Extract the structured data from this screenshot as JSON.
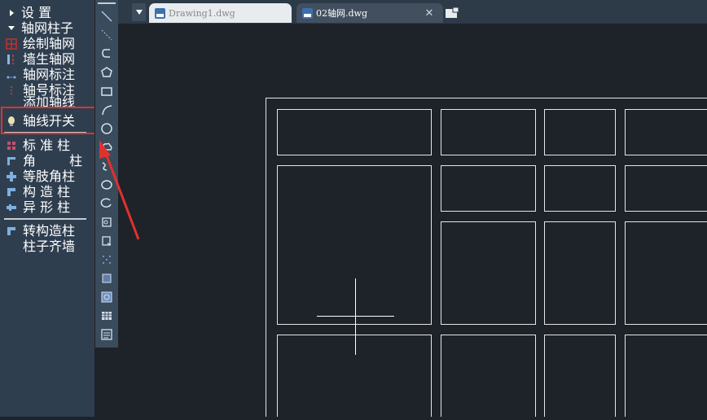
{
  "menu": {
    "items": [
      {
        "label": "设 置",
        "icon": "triangle-right-icon"
      },
      {
        "label": "轴网柱子",
        "icon": "triangle-down-icon"
      },
      {
        "label": "绘制轴网",
        "icon": "grid-icon"
      },
      {
        "label": "墙生轴网",
        "icon": "wall-axis-icon"
      },
      {
        "label": "轴网标注",
        "icon": "axis-dimension-icon"
      },
      {
        "label": "轴号标注",
        "icon": "axis-number-icon"
      },
      {
        "label": "添加轴线",
        "icon": "add-axis-icon"
      },
      {
        "label": "轴线开关",
        "icon": "bulb-icon"
      },
      {
        "label": "标 准 柱",
        "icon": "standard-column-icon"
      },
      {
        "label": "角 柱",
        "icon": "corner-column-icon"
      },
      {
        "label": "等肢角柱",
        "icon": "equal-leg-corner-column-icon"
      },
      {
        "label": "构 造 柱",
        "icon": "structural-column-icon"
      },
      {
        "label": "异 形 柱",
        "icon": "shaped-column-icon"
      },
      {
        "label": "转构造柱",
        "icon": "convert-structural-column-icon"
      },
      {
        "label": "柱子齐墙",
        "icon": "align-column-wall-icon"
      }
    ]
  },
  "toolbar": {
    "tools": [
      "line-icon",
      "construction-line-icon",
      "polyline-icon",
      "polygon-icon",
      "rectangle-icon",
      "arc-icon",
      "circle-icon",
      "revision-cloud-icon",
      "spline-icon",
      "ellipse-icon",
      "ellipse-arc-icon",
      "insert-block-icon",
      "make-block-icon",
      "point-icon",
      "hatch-icon",
      "gradient-icon",
      "table-icon",
      "multiline-text-icon"
    ]
  },
  "tabs": [
    {
      "label": "Drawing1.dwg",
      "active": false
    },
    {
      "label": "02轴网.dwg",
      "active": true
    }
  ],
  "colors": {
    "accent_red": "#e0322c",
    "canvas": "#1e2229",
    "panel": "#2e3e4f"
  }
}
